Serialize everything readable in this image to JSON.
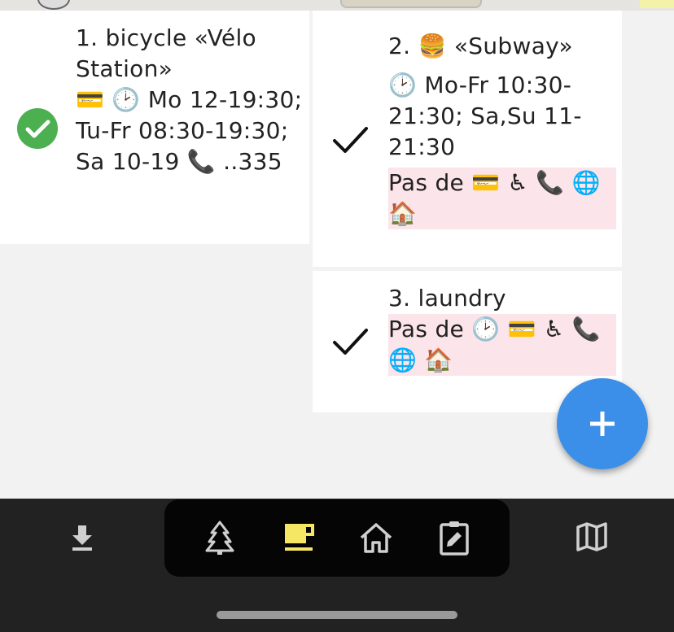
{
  "cards": [
    {
      "title": "1. bicycle «Vélo Station»",
      "line1": "💳 🕑 Mo 12-19:30; Tu-Fr 08:30-19:30; Sa 10-19 📞 ..335",
      "status": "checked-circle"
    },
    {
      "title": "2. 🍔 «Subway»",
      "hours": "🕑 Mo-Fr 10:30-21:30; Sa,Su 11-21:30",
      "missing_prefix": "Pas de",
      "missing_icons": "💳 ♿ 📞 🌐 🏠",
      "status": "checked"
    },
    {
      "title": "3. laundry",
      "missing_prefix": "Pas de",
      "missing_icons": "🕑 💳 ♿ 📞 🌐 🏠",
      "status": "checked"
    }
  ],
  "fab": {
    "icon": "plus-icon"
  },
  "bottom_nav": {
    "left": "download-icon",
    "tabs": [
      "tree-icon",
      "cup-icon",
      "home-icon",
      "clipboard-edit-icon"
    ],
    "active_tab": "cup-icon",
    "right": "map-icon",
    "active_color": "#f5e663",
    "icon_color": "#d0d0d0"
  }
}
